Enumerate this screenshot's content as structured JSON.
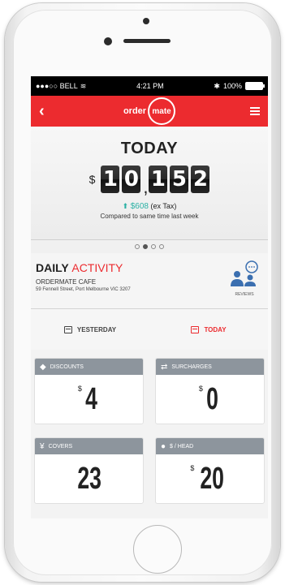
{
  "status_bar": {
    "carrier": "●●●○○ BELL",
    "time": "4:21 PM",
    "battery": "100%"
  },
  "app_bar": {
    "logo_left": "order",
    "logo_circle": "mate"
  },
  "today_panel": {
    "title": "TODAY",
    "currency": "$",
    "digits": [
      "1",
      "0",
      "1",
      "5",
      "2"
    ],
    "comma": ",",
    "change_arrow": "⬆",
    "change_amount": "$608",
    "change_note": "(ex Tax)",
    "compare_text": "Compared to same time last week"
  },
  "pager": {
    "active_index": 1,
    "count": 4
  },
  "daily_activity": {
    "heading_bold": "DAILY",
    "heading_accent": "ACTIVITY",
    "venue": "ORDERMATE CAFE",
    "address": "59 Fennell Street, Port Melbourne VIC 3207",
    "reviews_label": "REVIEWS"
  },
  "tabs": [
    {
      "label": "YESTERDAY",
      "active": false
    },
    {
      "label": "TODAY",
      "active": true
    }
  ],
  "cards": [
    {
      "label": "DISCOUNTS",
      "currency": "$",
      "value": "4",
      "icon": "tag-icon"
    },
    {
      "label": "SURCHARGES",
      "currency": "$",
      "value": "0",
      "icon": "arrows-icon"
    },
    {
      "label": "COVERS",
      "currency": "",
      "value": "23",
      "icon": "cutlery-icon"
    },
    {
      "label": "$ / HEAD",
      "currency": "$",
      "value": "20",
      "icon": "person-icon"
    }
  ],
  "colors": {
    "brand_red": "#ec2b2f",
    "card_header": "#8d959d",
    "accent_teal": "#2ab0a4"
  }
}
